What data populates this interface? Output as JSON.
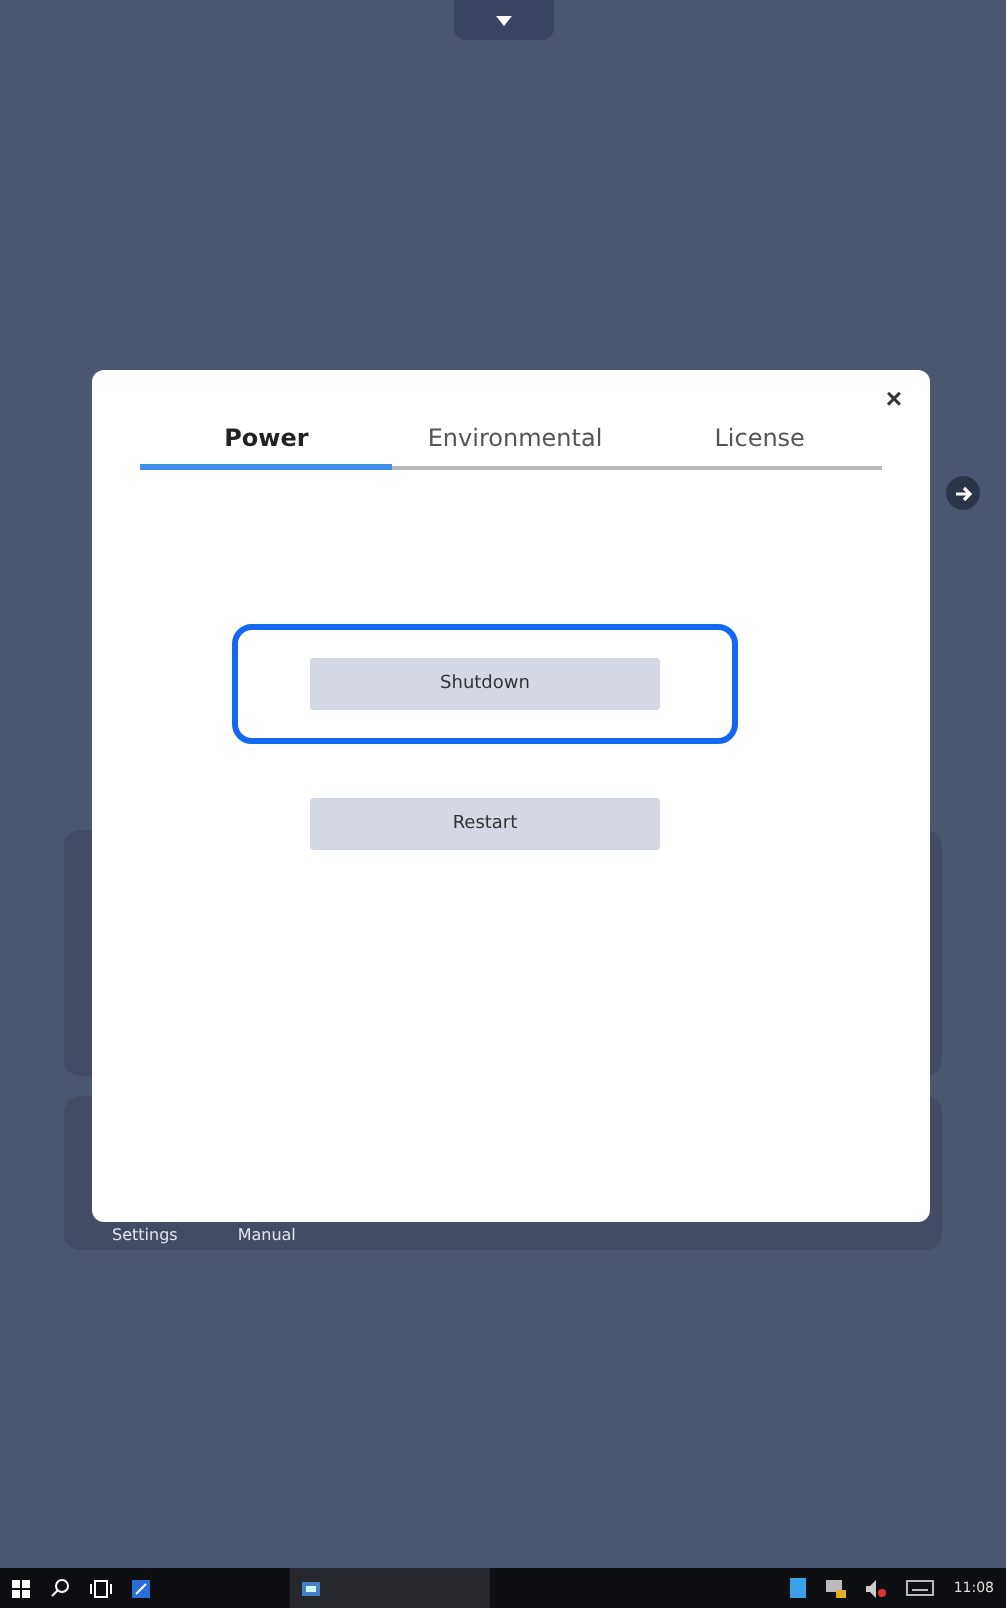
{
  "background": {
    "shortcuts": [
      {
        "label": "Settings"
      },
      {
        "label": "Manual"
      }
    ]
  },
  "dialog": {
    "close": "×",
    "tabs": [
      {
        "label": "Power",
        "selected": true
      },
      {
        "label": "Environmental",
        "selected": false
      },
      {
        "label": "License",
        "selected": false
      }
    ],
    "actions": [
      {
        "label": "Shutdown",
        "highlighted": true
      },
      {
        "label": "Restart",
        "highlighted": false
      }
    ]
  },
  "taskbar": {
    "time": "11:08"
  }
}
